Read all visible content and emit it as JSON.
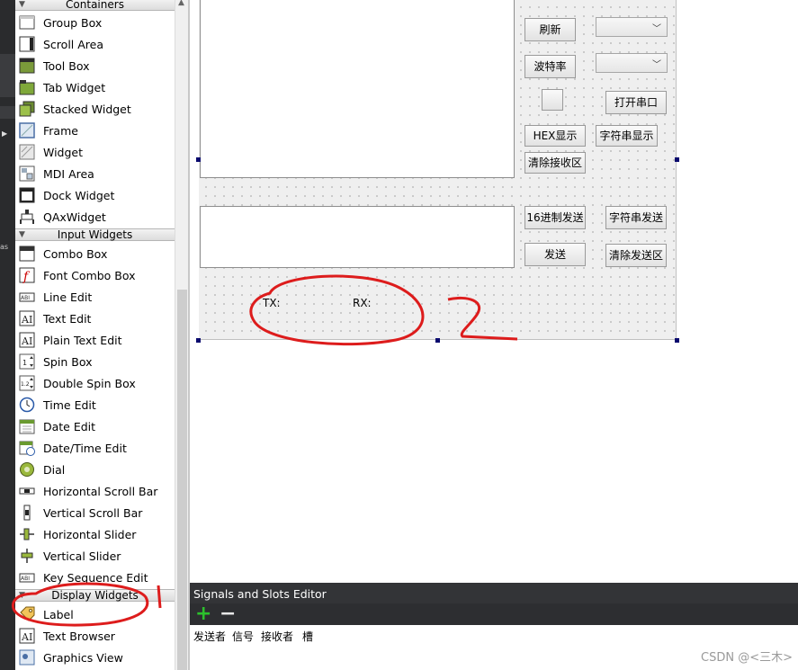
{
  "left_strip": {
    "label": "as"
  },
  "widget_box": {
    "categories": {
      "containers": "Containers",
      "input_widgets": "Input Widgets",
      "display_widgets": "Display Widgets"
    },
    "containers_items": [
      "Group Box",
      "Scroll Area",
      "Tool Box",
      "Tab Widget",
      "Stacked Widget",
      "Frame",
      "Widget",
      "MDI Area",
      "Dock Widget",
      "QAxWidget"
    ],
    "input_items": [
      "Combo Box",
      "Font Combo Box",
      "Line Edit",
      "Text Edit",
      "Plain Text Edit",
      "Spin Box",
      "Double Spin Box",
      "Time Edit",
      "Date Edit",
      "Date/Time Edit",
      "Dial",
      "Horizontal Scroll Bar",
      "Vertical Scroll Bar",
      "Horizontal Slider",
      "Vertical Slider",
      "Key Sequence Edit"
    ],
    "display_items": [
      "Label",
      "Text Browser",
      "Graphics View"
    ]
  },
  "form": {
    "buttons": {
      "refresh": "刷新",
      "baud_rate": "波特率",
      "open_port": "打开串口",
      "hex_display": "HEX显示",
      "string_display": "字符串显示",
      "clear_receive": "清除接收区",
      "hex_send": "16进制发送",
      "string_send": "字符串发送",
      "send": "发送",
      "clear_send": "清除发送区"
    },
    "labels": {
      "tx": "TX:",
      "rx": "RX:"
    }
  },
  "signals_slots": {
    "title": "Signals and Slots Editor",
    "columns": [
      "发送者",
      "信号",
      "接收者",
      "槽"
    ]
  },
  "annotation": {
    "number": "2"
  },
  "watermark": "CSDN @<三木>",
  "colors": {
    "annotation_red": "#dd1c1c",
    "handle_blue": "#0a0a6e",
    "dark_panel": "#333437"
  }
}
